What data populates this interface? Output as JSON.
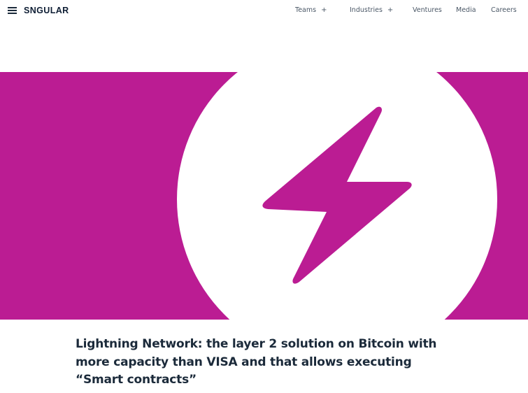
{
  "header": {
    "logo_text": "SNGULAR",
    "nav": [
      {
        "label": "Teams",
        "has_submenu": true,
        "submenu_symbol": "+"
      },
      {
        "label": "Industries",
        "has_submenu": true,
        "submenu_symbol": "+"
      },
      {
        "label": "Ventures",
        "has_submenu": false
      },
      {
        "label": "Media",
        "has_submenu": false
      },
      {
        "label": "Careers",
        "has_submenu": false
      }
    ]
  },
  "hero": {
    "background_color": "#bb1c93",
    "circle_color": "#ffffff",
    "icon": "lightning-bolt-icon",
    "icon_color": "#bb1c93"
  },
  "article": {
    "title": "Lightning Network: the layer 2 solution on Bitcoin with more capacity than VISA and that allows executing “Smart contracts”"
  }
}
